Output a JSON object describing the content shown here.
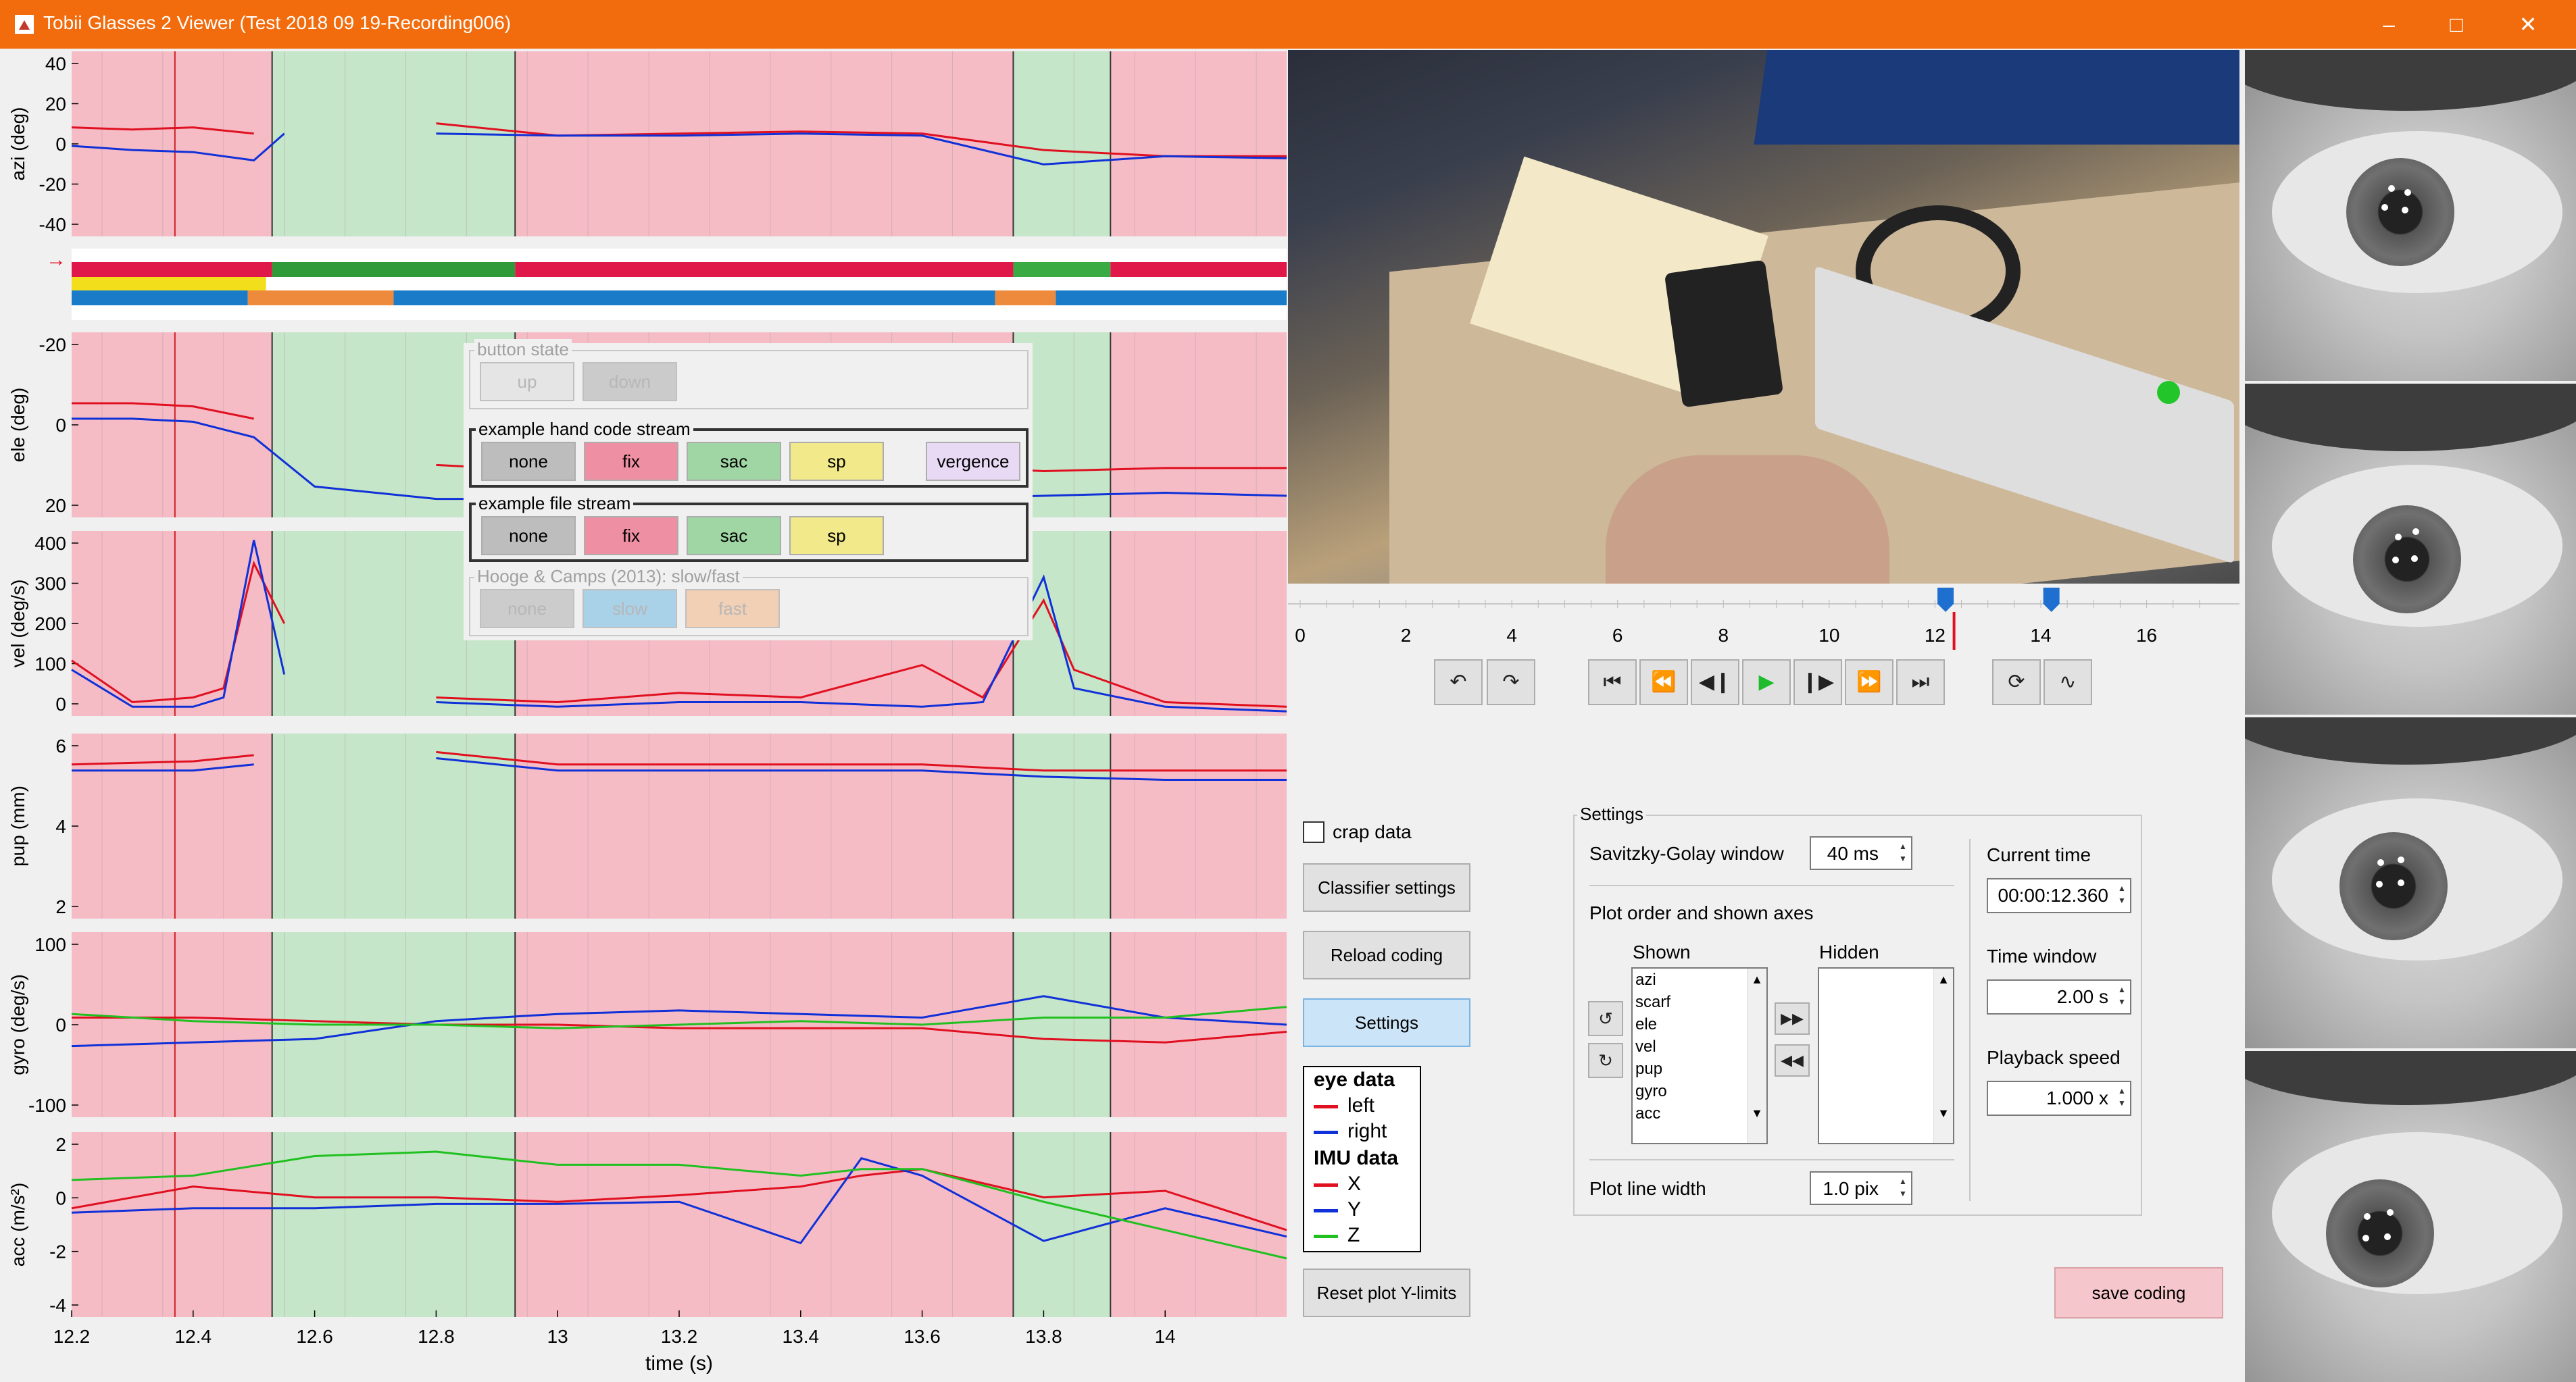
{
  "window": {
    "title": "Tobii Glasses 2 Viewer (Test 2018 09 19-Recording006)",
    "controls": [
      "minimize",
      "maximize",
      "close"
    ]
  },
  "plots": {
    "panels": [
      {
        "id": "azi",
        "ylabel": "azi (deg)",
        "ticks": [
          "40",
          "20",
          "0",
          "-20",
          "-40"
        ]
      },
      {
        "id": "scarf",
        "ylabel": "",
        "ticks": [],
        "arrow": "→"
      },
      {
        "id": "ele",
        "ylabel": "ele (deg)",
        "ticks": [
          "-20",
          "0",
          "20"
        ]
      },
      {
        "id": "vel",
        "ylabel": "vel (deg/s)",
        "ticks": [
          "400",
          "300",
          "200",
          "100",
          "0"
        ]
      },
      {
        "id": "pup",
        "ylabel": "pup (mm)",
        "ticks": [
          "6",
          "4",
          "2"
        ]
      },
      {
        "id": "gyro",
        "ylabel": "gyro (deg/s)",
        "ticks": [
          "100",
          "0",
          "-100"
        ]
      },
      {
        "id": "acc",
        "ylabel": "acc (m/s²)",
        "ticks": [
          "2",
          "0",
          "-2",
          "-4"
        ]
      }
    ],
    "x_ticks": [
      "12.2",
      "12.4",
      "12.6",
      "12.8",
      "13",
      "13.2",
      "13.4",
      "13.6",
      "13.8",
      "14"
    ],
    "xlabel": "time (s)",
    "colors": {
      "pink": "#f5bcc6",
      "green": "#c5e6c8",
      "left": "#e01020",
      "right": "#1030d8",
      "z": "#20c020"
    }
  },
  "chart_data": [
    {
      "type": "line",
      "ylabel": "azi (deg)",
      "ylim": [
        -45,
        45
      ],
      "x": [
        12.2,
        12.3,
        12.4,
        12.5,
        12.55,
        12.6,
        12.8,
        13.0,
        13.2,
        13.4,
        13.6,
        13.8,
        14.0,
        14.2
      ],
      "series": [
        {
          "name": "left",
          "values": [
            8,
            7,
            8,
            5,
            null,
            null,
            10,
            4,
            5,
            6,
            5,
            -3,
            -6,
            -6
          ]
        },
        {
          "name": "right",
          "values": [
            -1,
            -3,
            -4,
            -8,
            5,
            null,
            5,
            4,
            4,
            5,
            4,
            -10,
            -6,
            -7
          ]
        }
      ]
    },
    {
      "type": "line",
      "ylabel": "ele (deg)",
      "ylim": [
        -30,
        30
      ],
      "x": [
        12.2,
        12.3,
        12.4,
        12.5,
        12.6,
        12.8,
        13.0,
        13.2,
        13.4,
        13.6,
        13.8,
        14.0,
        14.2
      ],
      "series": [
        {
          "name": "left",
          "values": [
            -7,
            -7,
            -6,
            -2,
            null,
            13,
            15,
            14,
            14,
            13,
            15,
            14,
            14
          ]
        },
        {
          "name": "right",
          "values": [
            -2,
            -2,
            -1,
            4,
            20,
            24,
            24,
            23,
            24,
            24,
            23,
            22,
            23
          ]
        }
      ]
    },
    {
      "type": "line",
      "ylabel": "vel (deg/s)",
      "ylim": [
        0,
        400
      ],
      "x": [
        12.2,
        12.3,
        12.4,
        12.45,
        12.5,
        12.55,
        12.6,
        12.8,
        13.0,
        13.2,
        13.4,
        13.6,
        13.7,
        13.8,
        13.85,
        14.0,
        14.2
      ],
      "series": [
        {
          "name": "left",
          "values": [
            120,
            30,
            40,
            60,
            330,
            200,
            null,
            40,
            30,
            50,
            40,
            110,
            40,
            250,
            100,
            30,
            20
          ]
        },
        {
          "name": "right",
          "values": [
            100,
            20,
            20,
            40,
            380,
            90,
            null,
            30,
            20,
            30,
            30,
            20,
            30,
            300,
            60,
            20,
            10
          ]
        }
      ]
    },
    {
      "type": "line",
      "ylabel": "pup (mm)",
      "ylim": [
        0,
        6
      ],
      "x": [
        12.2,
        12.4,
        12.5,
        12.6,
        12.8,
        13.0,
        13.2,
        13.4,
        13.6,
        13.8,
        14.0,
        14.2
      ],
      "series": [
        {
          "name": "left",
          "values": [
            5.0,
            5.1,
            5.3,
            null,
            5.4,
            5.0,
            5.0,
            5.0,
            5.0,
            4.8,
            4.8,
            4.8
          ]
        },
        {
          "name": "right",
          "values": [
            4.8,
            4.8,
            5.0,
            null,
            5.2,
            4.8,
            4.8,
            4.8,
            4.8,
            4.6,
            4.5,
            4.5
          ]
        }
      ]
    },
    {
      "type": "line",
      "ylabel": "gyro (deg/s)",
      "ylim": [
        -130,
        130
      ],
      "x": [
        12.2,
        12.4,
        12.6,
        12.8,
        13.0,
        13.2,
        13.4,
        13.6,
        13.8,
        14.0,
        14.2
      ],
      "series": [
        {
          "name": "X",
          "values": [
            10,
            10,
            5,
            0,
            0,
            -5,
            -5,
            -5,
            -20,
            -25,
            -10
          ]
        },
        {
          "name": "Y",
          "values": [
            -30,
            -25,
            -20,
            5,
            15,
            20,
            15,
            10,
            40,
            10,
            0
          ]
        },
        {
          "name": "Z",
          "values": [
            15,
            5,
            0,
            0,
            -5,
            0,
            5,
            0,
            10,
            10,
            25
          ]
        }
      ]
    },
    {
      "type": "line",
      "ylabel": "acc (m/s²)",
      "xlabel": "time (s)",
      "ylim": [
        -5,
        3.5
      ],
      "x": [
        12.2,
        12.4,
        12.6,
        12.8,
        13.0,
        13.2,
        13.4,
        13.5,
        13.6,
        13.8,
        14.0,
        14.2
      ],
      "series": [
        {
          "name": "X",
          "values": [
            0,
            1,
            0.5,
            0.5,
            0.3,
            0.6,
            1.0,
            1.5,
            1.8,
            0.5,
            0.8,
            -1
          ]
        },
        {
          "name": "Y",
          "values": [
            -0.2,
            0,
            0,
            0.2,
            0.2,
            0.3,
            -1.6,
            2.3,
            1.5,
            -1.5,
            0,
            -1.3
          ]
        },
        {
          "name": "Z",
          "values": [
            1.3,
            1.5,
            2.4,
            2.6,
            2.0,
            2.0,
            1.5,
            1.8,
            1.8,
            0.3,
            -1,
            -2.3
          ]
        }
      ]
    }
  ],
  "overlay": {
    "groups": [
      {
        "title": "button state",
        "dim": true,
        "buttons": [
          {
            "label": "up",
            "color": "#e1e1e1",
            "dim": true
          },
          {
            "label": "down",
            "color": "#bcbcbc",
            "dim": true
          }
        ]
      },
      {
        "title": "example hand code stream",
        "dim": false,
        "active": true,
        "buttons": [
          {
            "label": "none",
            "color": "#bdbdbd"
          },
          {
            "label": "fix",
            "color": "#ef8fa3"
          },
          {
            "label": "sac",
            "color": "#9fd6a4"
          },
          {
            "label": "sp",
            "color": "#f2ea8a"
          },
          {
            "label": "vergence",
            "color": "#e8d9f5"
          }
        ]
      },
      {
        "title": "example file stream",
        "dim": false,
        "active": true,
        "buttons": [
          {
            "label": "none",
            "color": "#bdbdbd"
          },
          {
            "label": "fix",
            "color": "#ef8fa3"
          },
          {
            "label": "sac",
            "color": "#9fd6a4"
          },
          {
            "label": "sp",
            "color": "#f2ea8a"
          }
        ]
      },
      {
        "title": "Hooge & Camps (2013): slow/fast",
        "dim": true,
        "buttons": [
          {
            "label": "none",
            "color": "#bdbdbd",
            "dim": true
          },
          {
            "label": "slow",
            "color": "#8cc4e6",
            "dim": true
          },
          {
            "label": "fast",
            "color": "#f3c39d",
            "dim": true
          }
        ]
      }
    ]
  },
  "timeline": {
    "ticks": [
      "0",
      "2",
      "4",
      "6",
      "8",
      "10",
      "12",
      "14",
      "16"
    ],
    "current": 12.36,
    "window_start": 12.2,
    "window_end": 14.2
  },
  "playback": {
    "buttons": [
      "undo-icon",
      "redo-icon",
      "skip-start-icon",
      "rewind-icon",
      "step-back-icon",
      "play-icon",
      "step-forward-icon",
      "fast-forward-icon",
      "skip-end-icon",
      "loop-icon",
      "scroll-icon"
    ]
  },
  "left_controls": {
    "crap_data": "crap data",
    "classifier": "Classifier settings",
    "reload": "Reload coding",
    "settings": "Settings",
    "reset": "Reset plot Y-limits"
  },
  "legend": {
    "eye_header": "eye data",
    "left": "left",
    "right": "right",
    "imu_header": "IMU data",
    "x": "X",
    "y": "Y",
    "z": "Z"
  },
  "settings": {
    "title": "Settings",
    "sg_label": "Savitzky-Golay window",
    "sg_value": "40 ms",
    "plot_order_label": "Plot order and shown axes",
    "shown_label": "Shown",
    "hidden_label": "Hidden",
    "shown_items": [
      "azi",
      "scarf",
      "ele",
      "vel",
      "pup",
      "gyro",
      "acc"
    ],
    "line_width_label": "Plot line width",
    "line_width_value": "1.0 pix",
    "current_time_label": "Current time",
    "current_time_value": "00:00:12.360",
    "time_window_label": "Time window",
    "time_window_value": "2.00 s",
    "playback_speed_label": "Playback speed",
    "playback_speed_value": "1.000 x"
  },
  "save_coding": "save coding"
}
